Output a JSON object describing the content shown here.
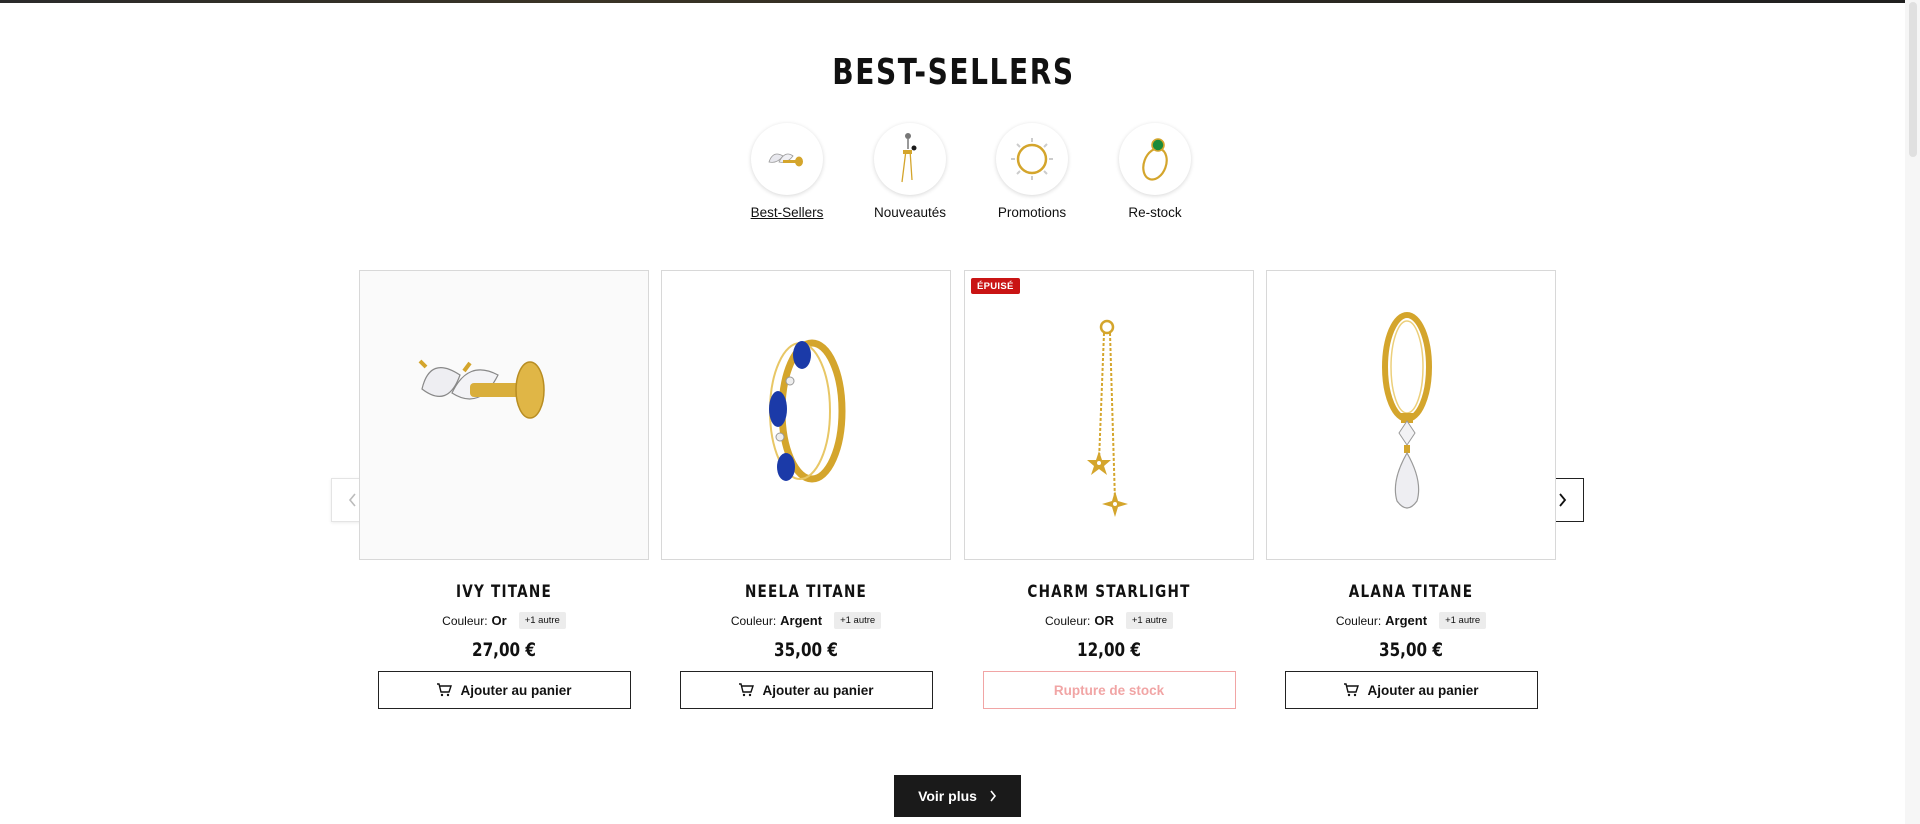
{
  "section": {
    "title": "BEST-SELLERS"
  },
  "categories": [
    {
      "label": "Best-Sellers",
      "icon": "leaf-earring-icon",
      "active": true
    },
    {
      "label": "Nouveautés",
      "icon": "chain-earring-icon",
      "active": false
    },
    {
      "label": "Promotions",
      "icon": "sun-hoop-icon",
      "active": false
    },
    {
      "label": "Re-stock",
      "icon": "green-stone-ring-icon",
      "active": false
    }
  ],
  "products": [
    {
      "name": "IVY TITANE",
      "color_label": "Couleur:",
      "color_value": "Or",
      "more_colors": "+1 autre",
      "price": "27,00 €",
      "button": "Ajouter au panier",
      "badge": "",
      "in_stock": true,
      "image": "leaf-stud-icon"
    },
    {
      "name": "NEELA TITANE",
      "color_label": "Couleur:",
      "color_value": "Argent",
      "more_colors": "+1 autre",
      "price": "35,00 €",
      "button": "Ajouter au panier",
      "badge": "",
      "in_stock": true,
      "image": "sapphire-hoop-icon"
    },
    {
      "name": "CHARM STARLIGHT",
      "color_label": "Couleur:",
      "color_value": "OR",
      "more_colors": "+1 autre",
      "price": "12,00 €",
      "button": "Rupture de stock",
      "badge": "ÉPUISÉ",
      "in_stock": false,
      "image": "star-chain-charm-icon"
    },
    {
      "name": "ALANA TITANE",
      "color_label": "Couleur:",
      "color_value": "Argent",
      "more_colors": "+1 autre",
      "price": "35,00 €",
      "button": "Ajouter au panier",
      "badge": "",
      "in_stock": true,
      "image": "drop-hoop-icon"
    }
  ],
  "carousel": {
    "prev_icon": "chevron-left-icon",
    "next_icon": "chevron-right-icon"
  },
  "cta": {
    "label": "Voir plus",
    "icon": "chevron-right-icon"
  },
  "colors": {
    "gold": "#d4a52c",
    "sold_out": "#c91414",
    "oos_text": "#f1a5a5",
    "dark": "#1a1a1a"
  }
}
